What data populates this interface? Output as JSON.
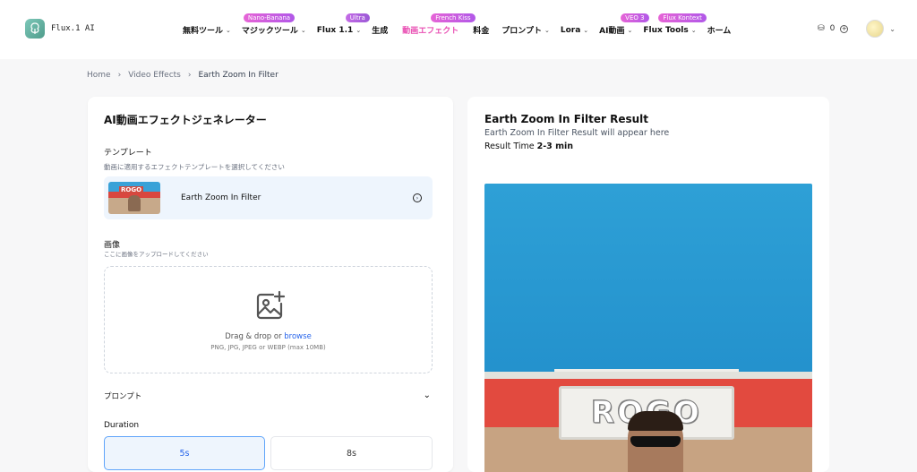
{
  "header": {
    "app_name": "Flux.1 AI",
    "nav": [
      {
        "label": "無料ツール",
        "chevron": true,
        "badge": "",
        "active": false
      },
      {
        "label": "マジックツール",
        "chevron": true,
        "badge": "Nano-Banana",
        "active": false
      },
      {
        "label": "Flux 1.1",
        "chevron": true,
        "badge": "Ultra",
        "active": false
      },
      {
        "label": "生成",
        "chevron": false,
        "badge": "",
        "active": false
      },
      {
        "label": "動画エフェクト",
        "chevron": false,
        "badge": "French Kiss",
        "active": true
      },
      {
        "label": "料金",
        "chevron": false,
        "badge": "",
        "active": false
      },
      {
        "label": "プロンプト",
        "chevron": true,
        "badge": "",
        "active": false
      },
      {
        "label": "Lora",
        "chevron": true,
        "badge": "",
        "active": false
      },
      {
        "label": "AI動画",
        "chevron": true,
        "badge": "VEO 3",
        "active": false
      },
      {
        "label": "Flux Tools",
        "chevron": true,
        "badge": "Flux Kontext",
        "active": false
      },
      {
        "label": "ホーム",
        "chevron": false,
        "badge": "",
        "active": false
      }
    ],
    "credits": "0"
  },
  "breadcrumb": {
    "home": "Home",
    "section": "Video Effects",
    "current": "Earth Zoom In Filter"
  },
  "left": {
    "title": "AI動画エフェクトジェネレーター",
    "template_label": "テンプレート",
    "template_hint": "動画に適用するエフェクトテンプレートを選択してください",
    "template_name": "Earth Zoom In Filter",
    "template_thumb_text": "ROGO",
    "image_label": "画像",
    "image_hint": "ここに画像をアップロードしてください",
    "drop_text": "Drag & drop or",
    "browse_text": "browse",
    "file_note": "PNG, JPG, JPEG or WEBP (max 10MB)",
    "prompt_label": "プロンプト",
    "duration_label": "Duration",
    "durations": [
      "5s",
      "8s"
    ],
    "selected_duration": "5s"
  },
  "right": {
    "title": "Earth Zoom In Filter Result",
    "subtitle": "Earth Zoom In Filter Result will appear here",
    "time_label": "Result Time",
    "time_value": "2-3 min",
    "sign_text": "ROGO"
  },
  "colors": {
    "accent": "#e94fb3",
    "link": "#2563eb",
    "selected_border": "#60a5fa"
  }
}
